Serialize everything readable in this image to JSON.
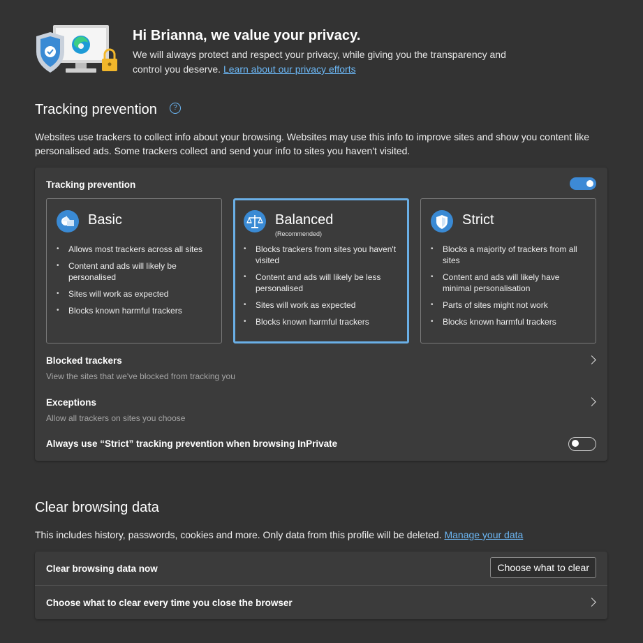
{
  "hero": {
    "title": "Hi Brianna, we value your privacy.",
    "text": "We will always protect and respect your privacy, while giving you the transparency and control you deserve.",
    "link": "Learn about our privacy efforts"
  },
  "tracking": {
    "title": "Tracking prevention",
    "help_icon": "question-circle-icon",
    "description": "Websites use trackers to collect info about your browsing. Websites may use this info to improve sites and show you content like personalised ads. Some trackers collect and send your info to sites you haven't visited.",
    "card_label": "Tracking prevention",
    "enabled": true,
    "levels": [
      {
        "name": "Basic",
        "sub": "",
        "icon": "basic-shapes-icon",
        "selected": false,
        "bullets": [
          "Allows most trackers across all sites",
          "Content and ads will likely be personalised",
          "Sites will work as expected",
          "Blocks known harmful trackers"
        ]
      },
      {
        "name": "Balanced",
        "sub": "(Recommended)",
        "icon": "scales-icon",
        "selected": true,
        "bullets": [
          "Blocks trackers from sites you haven't visited",
          "Content and ads will likely be less personalised",
          "Sites will work as expected",
          "Blocks known harmful trackers"
        ]
      },
      {
        "name": "Strict",
        "sub": "",
        "icon": "shield-icon",
        "selected": false,
        "bullets": [
          "Blocks a majority of trackers from all sites",
          "Content and ads will likely have minimal personalisation",
          "Parts of sites might not work",
          "Blocks known harmful trackers"
        ]
      }
    ],
    "blocked": {
      "label": "Blocked trackers",
      "sub": "View the sites that we've blocked from tracking you"
    },
    "exceptions": {
      "label": "Exceptions",
      "sub": "Allow all trackers on sites you choose"
    },
    "inprivate": {
      "label": "Always use “Strict” tracking prevention when browsing InPrivate",
      "enabled": false
    }
  },
  "clear": {
    "title": "Clear browsing data",
    "description": "This includes history, passwords, cookies and more. Only data from this profile will be deleted.",
    "link": "Manage your data",
    "now_label": "Clear browsing data now",
    "button": "Choose what to clear",
    "on_close_label": "Choose what to clear every time you close the browser"
  },
  "colors": {
    "accent": "#3a8ad4",
    "link": "#6cb8f6",
    "background": "#333333",
    "card": "#3b3b3b"
  }
}
